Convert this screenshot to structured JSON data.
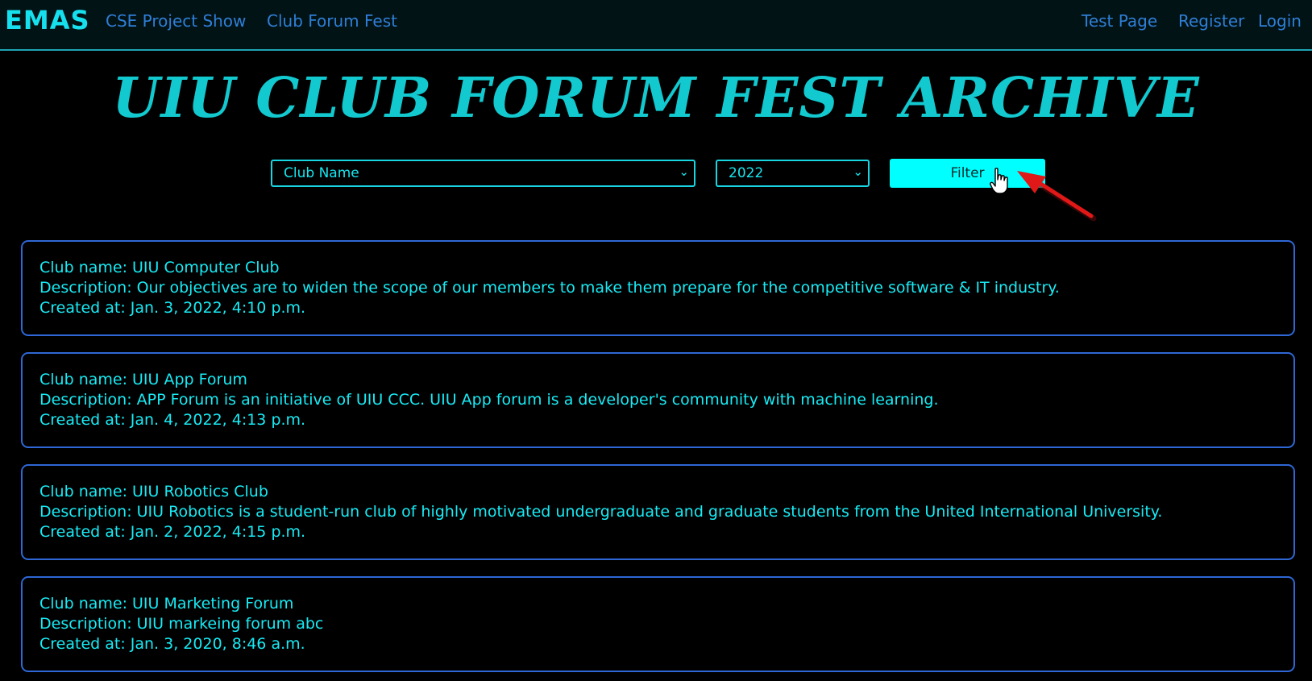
{
  "nav": {
    "brand": "EMAS",
    "left_links": [
      "CSE Project Show",
      "Club Forum Fest"
    ],
    "right_links": [
      "Test Page",
      "Register",
      "Login"
    ]
  },
  "page": {
    "title": "UIU CLUB FORUM FEST ARCHIVE"
  },
  "filters": {
    "club_select_value": "Club Name",
    "year_select_value": "2022",
    "filter_button_label": "Filter"
  },
  "clubs": [
    {
      "name_line": "Club name: UIU Computer Club",
      "description_line": "Description: Our objectives are to widen the scope of our members to make them prepare for the competitive software & IT industry.",
      "created_line": "Created at: Jan. 3, 2022, 4:10 p.m."
    },
    {
      "name_line": "Club name: UIU App Forum",
      "description_line": "Description: APP Forum is an initiative of UIU CCC. UIU App forum is a developer's community with machine learning.",
      "created_line": "Created at: Jan. 4, 2022, 4:13 p.m."
    },
    {
      "name_line": "Club name: UIU Robotics Club",
      "description_line": "Description: UIU Robotics is a student-run club of highly motivated undergraduate and graduate students from the United International University.",
      "created_line": "Created at: Jan. 2, 2022, 4:15 p.m."
    },
    {
      "name_line": "Club name: UIU Marketing Forum",
      "description_line": "Description: UIU markeing forum abc",
      "created_line": "Created at: Jan. 3, 2020, 8:46 a.m."
    }
  ],
  "colors": {
    "accent": "#00ffff",
    "card_border": "#2f67d6",
    "link": "#2e7fd6",
    "annotation_arrow": "#e01818"
  },
  "icons": {
    "dropdown": "chevron-down-icon",
    "cursor": "hand-pointer-icon",
    "annotation": "red-arrow-icon"
  }
}
